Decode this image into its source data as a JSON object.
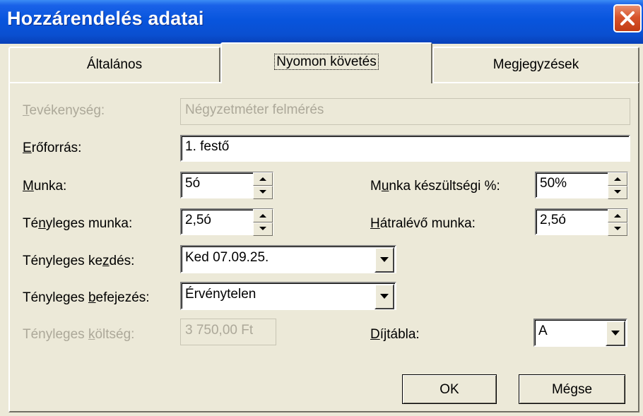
{
  "window": {
    "title": "Hozzárendelés adatai"
  },
  "tabs": [
    {
      "label": "Általános"
    },
    {
      "label": "Nyomon követés"
    },
    {
      "label": "Megjegyzések"
    }
  ],
  "form": {
    "task": {
      "label_u": "T",
      "label_rest": "evékenység:",
      "value": "Négyzetméter felmérés"
    },
    "resource": {
      "label_u": "E",
      "label_rest": "rőforrás:",
      "value": "1. festő"
    },
    "work": {
      "label_u": "M",
      "label_rest": "unka:",
      "value": "5ó"
    },
    "actual_work": {
      "label_pre": "Té",
      "label_u": "n",
      "label_rest": "yleges munka:",
      "value": "2,5ó"
    },
    "percent_work": {
      "label_pre": "M",
      "label_u": "u",
      "label_rest": "nka készültségi %:",
      "value": "50%"
    },
    "remaining_work": {
      "label_u": "H",
      "label_rest": "átralévő munka:",
      "value": "2,5ó"
    },
    "actual_start": {
      "label_pre": "Tényleges ke",
      "label_u": "z",
      "label_rest": "dés:",
      "value": "Ked 07.09.25."
    },
    "actual_finish": {
      "label_pre": "Tényleges ",
      "label_u": "b",
      "label_rest": "efejezés:",
      "value": "Érvénytelen"
    },
    "actual_cost": {
      "label_pre": "Tényleges ",
      "label_u": "k",
      "label_rest": "öltség:",
      "value": "3 750,00 Ft"
    },
    "rate_table": {
      "label_u": "D",
      "label_rest": "íjtábla:",
      "value": "A"
    }
  },
  "buttons": {
    "ok": "OK",
    "cancel": "Mégse"
  },
  "colors": {
    "title_bar": "#0855dd",
    "close_button": "#d8542c",
    "dialog_bg": "#ece9d8",
    "disabled_text": "#aca899"
  }
}
